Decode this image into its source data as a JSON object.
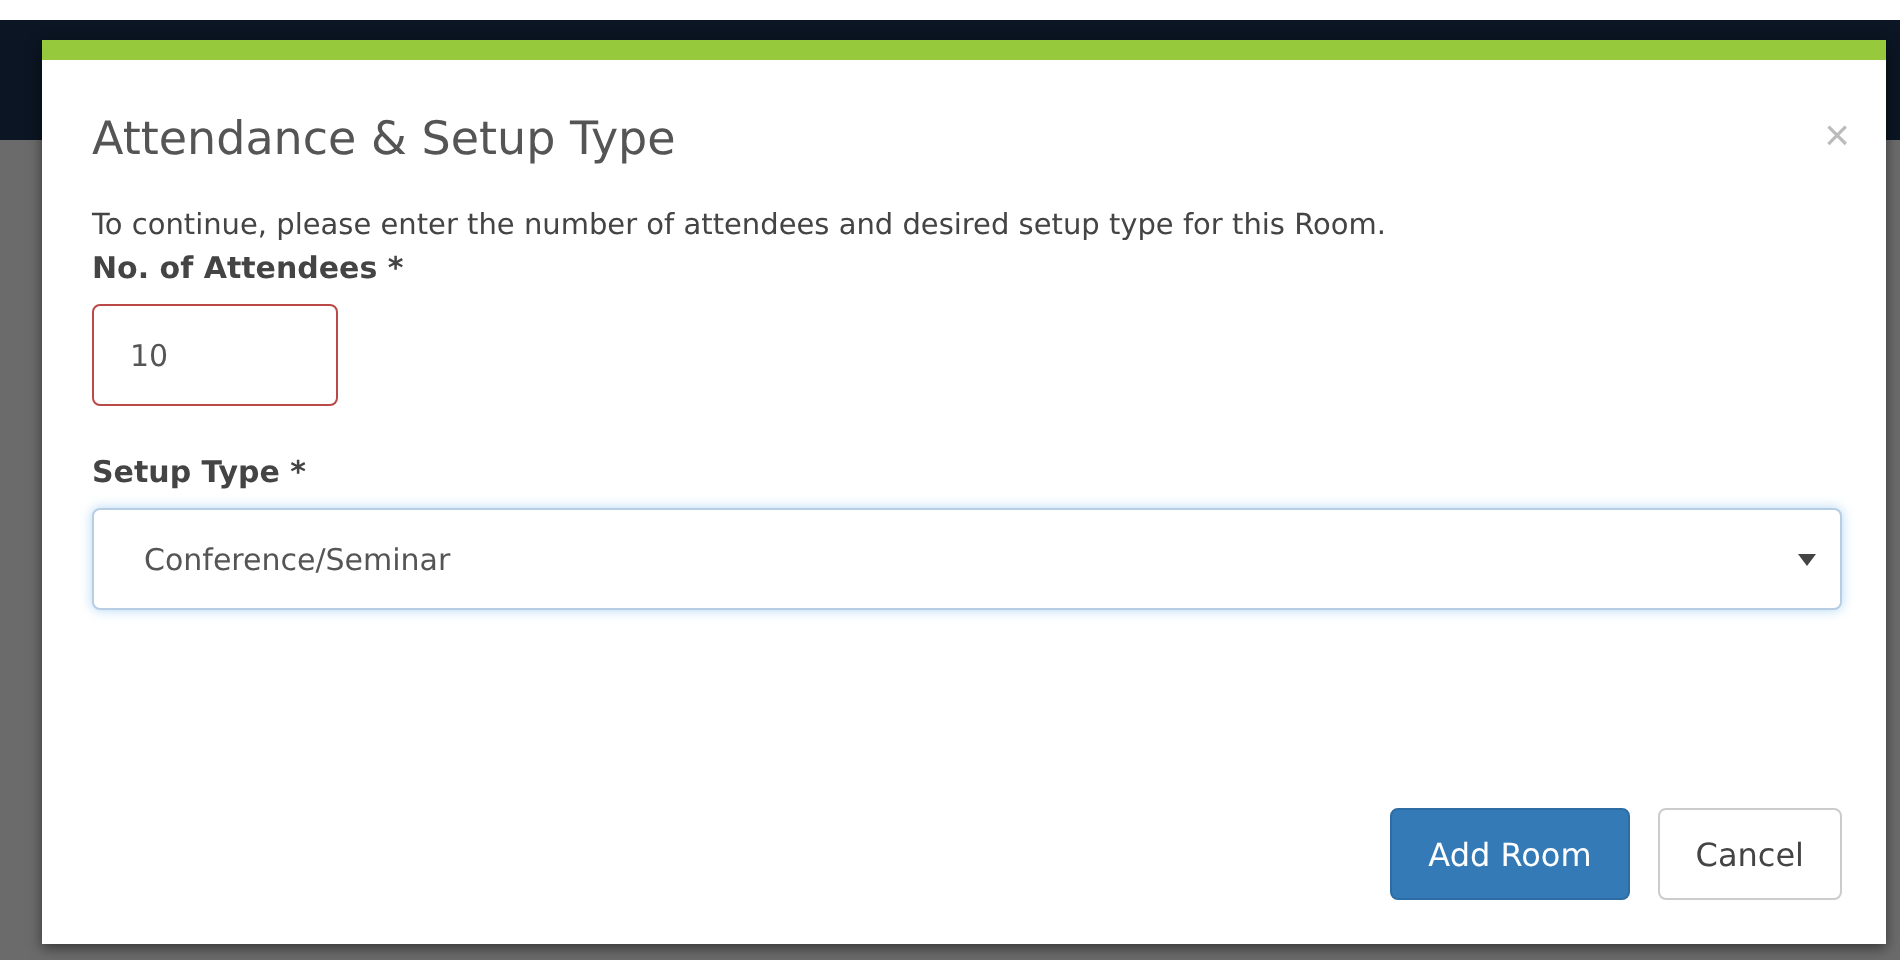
{
  "dialog": {
    "title": "Attendance & Setup Type",
    "close": "×",
    "description": "To continue, please enter the number of attendees and desired setup type for this Room.",
    "fields": [
      {
        "kind": "input",
        "label": "No. of Attendees *",
        "value": "10",
        "invalid": true,
        "focused": false
      },
      {
        "kind": "select",
        "label": "Setup Type *",
        "value": "Conference/Seminar",
        "invalid": false,
        "focused": true
      }
    ],
    "buttons": [
      {
        "label": "Add Room",
        "kind": "primary"
      },
      {
        "label": "Cancel",
        "kind": "default"
      }
    ]
  }
}
